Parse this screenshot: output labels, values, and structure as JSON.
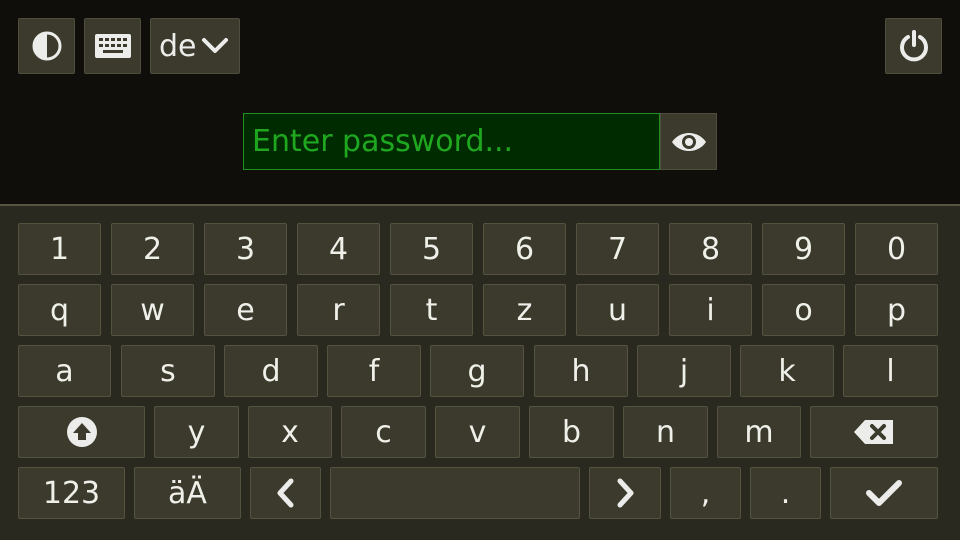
{
  "toolbar": {
    "contrast_icon": "contrast-icon",
    "keyboard_icon": "keyboard-icon",
    "language": "de",
    "language_icon": "chevron-down-icon",
    "power_icon": "power-icon"
  },
  "password": {
    "placeholder": "Enter password...",
    "value": "",
    "toggle_icon": "eye-icon"
  },
  "keyboard": {
    "row1": [
      "1",
      "2",
      "3",
      "4",
      "5",
      "6",
      "7",
      "8",
      "9",
      "0"
    ],
    "row2": [
      "q",
      "w",
      "e",
      "r",
      "t",
      "z",
      "u",
      "i",
      "o",
      "p"
    ],
    "row3": [
      "a",
      "s",
      "d",
      "f",
      "g",
      "h",
      "j",
      "k",
      "l"
    ],
    "row4": [
      "y",
      "x",
      "c",
      "v",
      "b",
      "n",
      "m"
    ],
    "numbers_label": "123",
    "umlaut_label": "äÄ",
    "comma_label": ",",
    "period_label": ".",
    "shift_icon": "shift-icon",
    "backspace_icon": "backspace-icon",
    "left_icon": "arrow-left-icon",
    "right_icon": "arrow-right-icon",
    "enter_icon": "checkmark-icon"
  },
  "colors": {
    "background": "#0f0e0b",
    "keyboard_background": "#2a2920",
    "key": "#3b3a2c",
    "input_background": "#002b00",
    "input_text": "#1fa81f"
  }
}
